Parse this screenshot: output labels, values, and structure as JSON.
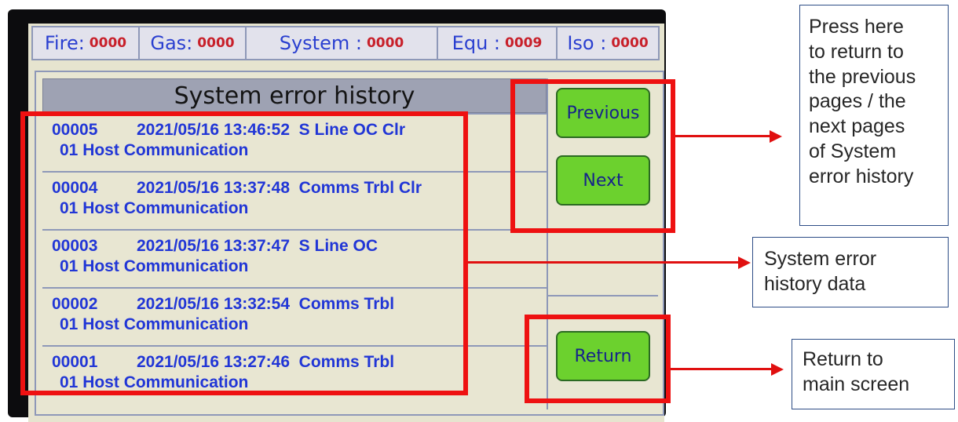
{
  "status_bar": {
    "items": [
      {
        "label": "Fire:",
        "value": "0000"
      },
      {
        "label": "Gas:",
        "value": "0000"
      },
      {
        "label": "System :",
        "value": "0000"
      },
      {
        "label": "Equ :",
        "value": "0009"
      },
      {
        "label": "Iso :",
        "value": "0000"
      }
    ]
  },
  "history": {
    "title": "System error history",
    "rows": [
      {
        "index": "00005",
        "datetime": "2021/05/16  13:46:52",
        "event": "S Line OC Clr",
        "source": "01  Host Communication"
      },
      {
        "index": "00004",
        "datetime": "2021/05/16  13:37:48",
        "event": "Comms Trbl Clr",
        "source": "01  Host Communication"
      },
      {
        "index": "00003",
        "datetime": "2021/05/16  13:37:47",
        "event": "S Line OC",
        "source": "01  Host Communication"
      },
      {
        "index": "00002",
        "datetime": "2021/05/16  13:32:54",
        "event": "Comms Trbl",
        "source": "01  Host Communication"
      },
      {
        "index": "00001",
        "datetime": "2021/05/16  13:27:46",
        "event": "Comms Trbl",
        "source": "01  Host Communication"
      }
    ]
  },
  "buttons": {
    "previous": "Previous",
    "next": "Next",
    "return": "Return"
  },
  "annotations": {
    "pages": [
      "Press here",
      "to return to",
      "the previous",
      "pages / the",
      "next pages",
      "of System",
      "error history"
    ],
    "data": [
      "System error",
      "history data"
    ],
    "return": [
      "Return to",
      "main screen"
    ]
  },
  "colors": {
    "button_green": "#6cd12e",
    "text_blue": "#2136d6",
    "value_red": "#c8202a",
    "highlight_red": "#ee1111"
  }
}
